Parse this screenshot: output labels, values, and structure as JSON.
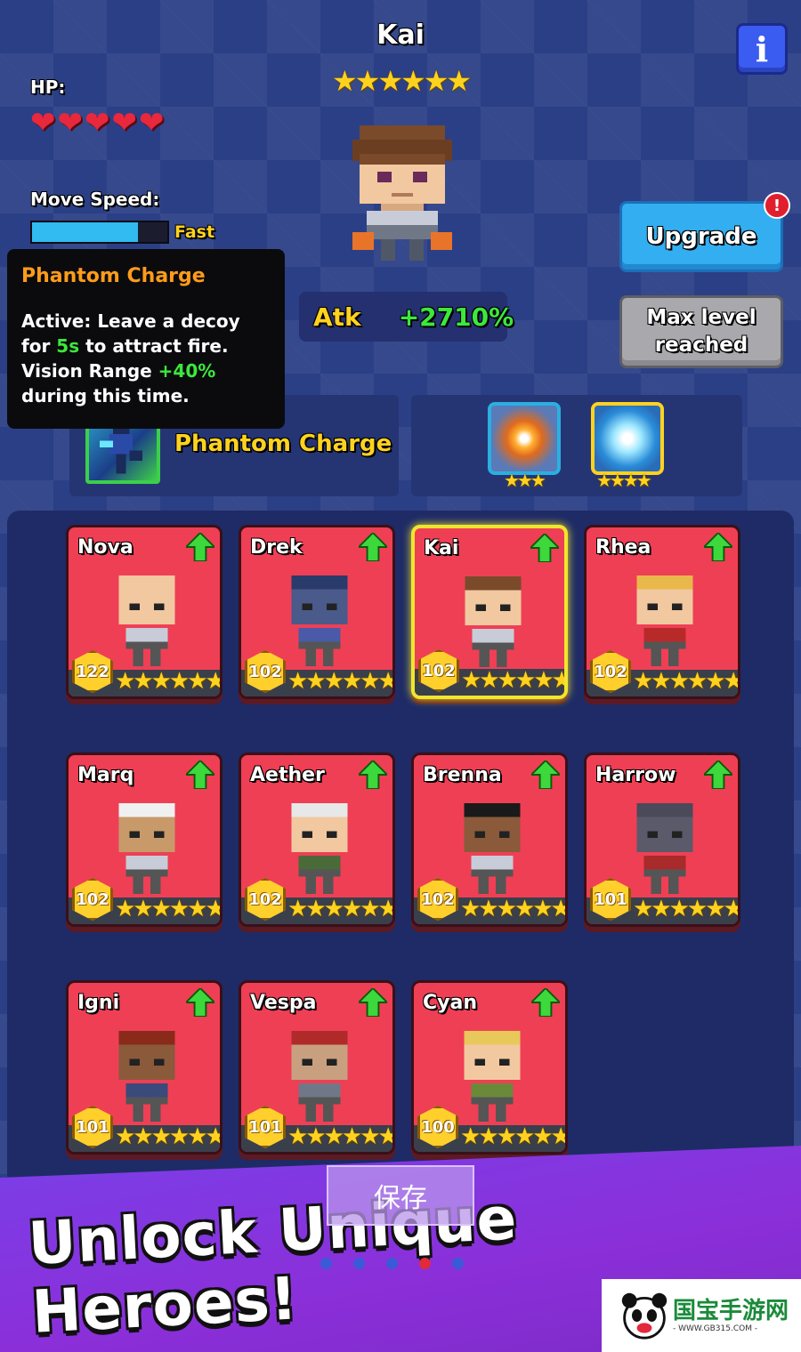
{
  "hero": {
    "name": "Kai",
    "stars": "★★★★★★",
    "hp_label": "HP:",
    "hearts": "❤❤❤❤❤",
    "speed_label": "Move Speed:",
    "speed_value": "Fast",
    "speed_fraction": 0.78,
    "atk_label": "Atk",
    "atk_value": "+2710%"
  },
  "buttons": {
    "upgrade": "Upgrade",
    "upgrade_badge": "!",
    "max_level": "Max level reached",
    "info": "i"
  },
  "tooltip": {
    "title": "Phantom Charge",
    "body_1": "Active: Leave a decoy",
    "body_2a": "for ",
    "body_2b": "5s",
    "body_2c": " to attract fire.",
    "body_3a": "Vision Range ",
    "body_3b": "+40%",
    "body_4": "during this time."
  },
  "skill": {
    "name": "Phantom Charge"
  },
  "gear": [
    {
      "icon": "fire-burst-icon",
      "stars": "★★★"
    },
    {
      "icon": "ice-burst-icon",
      "stars": "★★★★"
    }
  ],
  "roster": [
    {
      "name": "Nova",
      "level": "122",
      "stars": "★★★★★★",
      "selected": false
    },
    {
      "name": "Drek",
      "level": "102",
      "stars": "★★★★★★",
      "selected": false
    },
    {
      "name": "Kai",
      "level": "102",
      "stars": "★★★★★★",
      "selected": true
    },
    {
      "name": "Rhea",
      "level": "102",
      "stars": "★★★★★★",
      "selected": false
    },
    {
      "name": "Marq",
      "level": "102",
      "stars": "★★★★★★",
      "selected": false
    },
    {
      "name": "Aether",
      "level": "102",
      "stars": "★★★★★★",
      "selected": false
    },
    {
      "name": "Brenna",
      "level": "102",
      "stars": "★★★★★★",
      "selected": false
    },
    {
      "name": "Harrow",
      "level": "101",
      "stars": "★★★★★★",
      "selected": false
    },
    {
      "name": "Igni",
      "level": "101",
      "stars": "★★★★★★",
      "selected": false
    },
    {
      "name": "Vespa",
      "level": "101",
      "stars": "★★★★★★",
      "selected": false
    },
    {
      "name": "Cyan",
      "level": "100",
      "stars": "★★★★★★",
      "selected": false
    }
  ],
  "banner": {
    "save": "保存",
    "headline": "Unlock Unique Heroes!"
  },
  "watermark": {
    "name": "国宝手游网",
    "url": "- WWW.GB315.COM -"
  },
  "colors": {
    "background": "#2b3f86",
    "card": "#ef3f55",
    "accent_yellow": "#ffd21f",
    "accent_green": "#3ce83c",
    "upgrade_blue": "#33aef0"
  }
}
